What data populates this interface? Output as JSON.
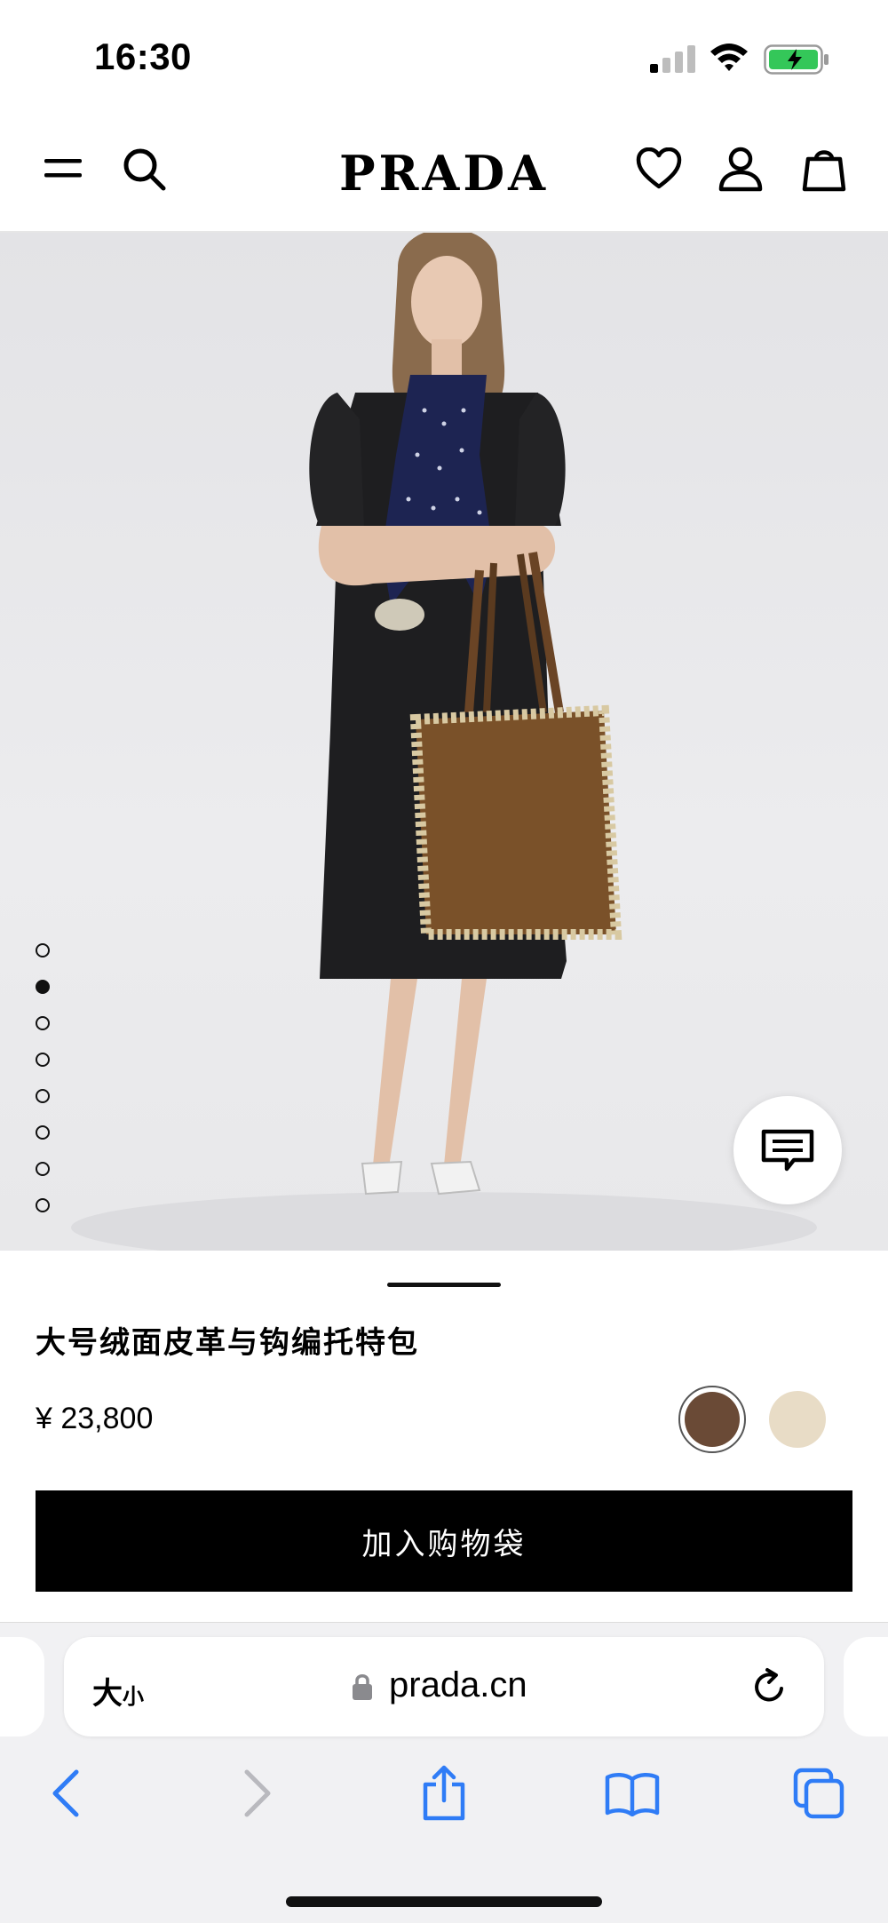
{
  "status_bar": {
    "time": "16:30"
  },
  "header": {
    "brand": "PRADA",
    "icons": [
      "menu-icon",
      "search-icon",
      "heart-icon",
      "account-icon",
      "bag-icon"
    ]
  },
  "gallery": {
    "image_count": 8,
    "active_index": 1
  },
  "product": {
    "title": "大号绒面皮革与钩编托特包",
    "price": "¥ 23,800",
    "colors": [
      "#6a4a36",
      "#e8dcc6"
    ],
    "selected_color_index": 0,
    "add_to_cart_label": "加入购物袋"
  },
  "browser": {
    "text_size_label_big": "大",
    "text_size_label_small": "小",
    "url": "prada.cn",
    "accent": "#2f7cf6"
  }
}
